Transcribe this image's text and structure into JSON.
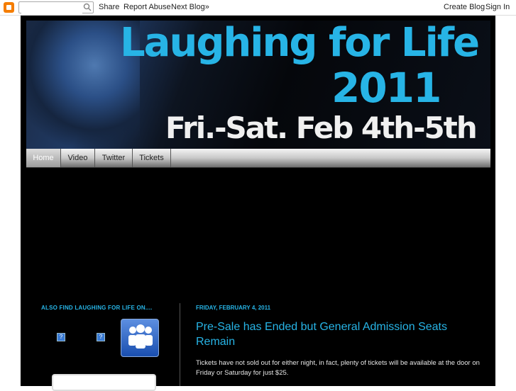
{
  "navbar": {
    "search_placeholder": "",
    "share_label": "Share",
    "report_label": "Report Abuse",
    "next_blog_label": "Next Blog»",
    "create_blog_label": "Create Blog",
    "sign_in_label": "Sign In"
  },
  "header": {
    "title_part1": "Laughing for ",
    "title_part2": "Life",
    "year": "2011",
    "dates": "Fri.-Sat. Feb 4th-5th"
  },
  "tabs": [
    {
      "label": "Home"
    },
    {
      "label": "Video"
    },
    {
      "label": "Twitter"
    },
    {
      "label": "Tickets"
    }
  ],
  "sidebar": {
    "title": "ALSO FIND LAUGHING FOR LIFE ON....",
    "missing_icon_glyph": "?"
  },
  "post": {
    "date": "FRIDAY, FEBRUARY 4, 2011",
    "title": "Pre-Sale has Ended but General Admission Seats Remain",
    "body": "Tickets have not sold out for either night, in fact, plenty of tickets will be available at the door on Friday or Saturday for just $25."
  },
  "colors": {
    "accent": "#27b4e6",
    "background": "#000000",
    "navbar_bg": "#ffffff",
    "blogger_orange": "#f57d00"
  }
}
